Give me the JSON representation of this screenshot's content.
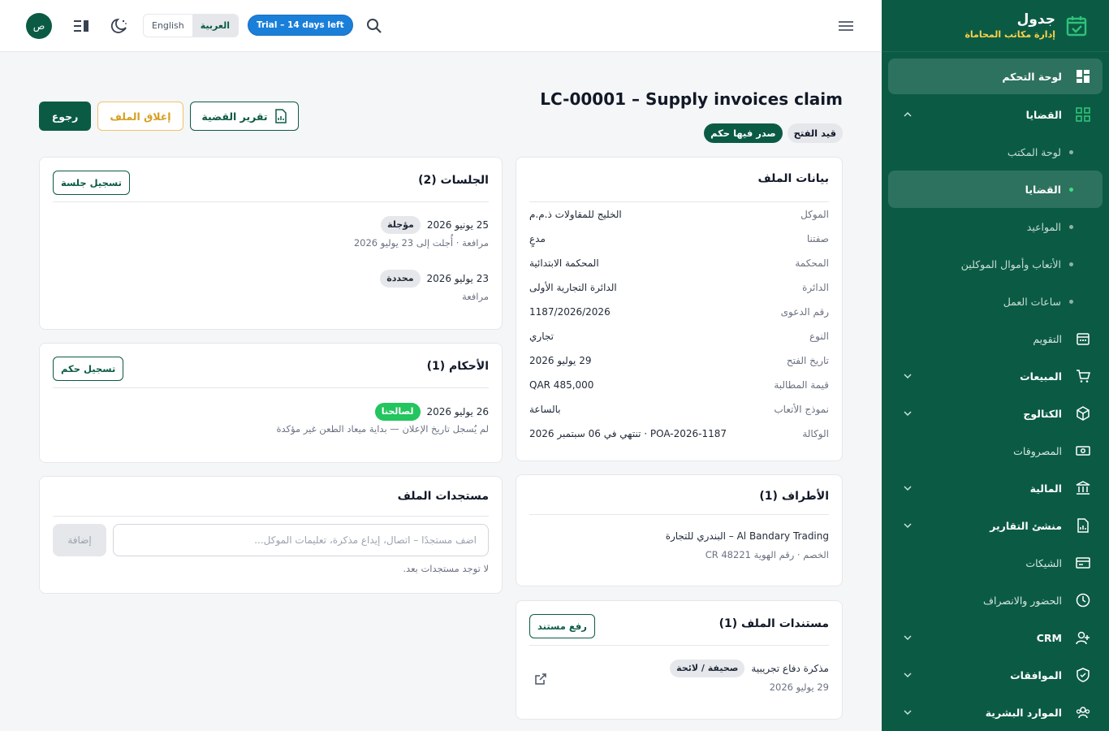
{
  "brand": {
    "name": "جدول",
    "subtitle": "إدارة مكاتب المحاماة"
  },
  "sidebar": {
    "items": [
      {
        "label": "لوحة التحكم"
      },
      {
        "label": "القضايا"
      },
      {
        "label": "لوحة المكتب"
      },
      {
        "label": "القضايا"
      },
      {
        "label": "المواعيد"
      },
      {
        "label": "الأتعاب وأموال الموكلين"
      },
      {
        "label": "ساعات العمل"
      },
      {
        "label": "التقويم"
      },
      {
        "label": "المبيعات"
      },
      {
        "label": "الكتالوج"
      },
      {
        "label": "المصروفات"
      },
      {
        "label": "المالية"
      },
      {
        "label": "منشئ التقارير"
      },
      {
        "label": "الشيكات"
      },
      {
        "label": "الحضور والانصراف"
      },
      {
        "label": "CRM"
      },
      {
        "label": "الموافقات"
      },
      {
        "label": "الموارد البشرية"
      }
    ]
  },
  "topbar": {
    "avatar": "ص",
    "lang_en": "English",
    "lang_ar": "العربية",
    "trial": "Trial – 14 days left"
  },
  "page": {
    "title": "LC-00001 – Supply invoices claim",
    "status_open": "قيد الفتح",
    "status_judged": "صدر فيها حكم",
    "btn_back": "رجوع",
    "btn_close": "إغلاق الملف",
    "btn_report": "تقرير القضية"
  },
  "file_info": {
    "title": "بيانات الملف",
    "rows": [
      {
        "k": "الموكل",
        "v": "الخليج للمقاولات ذ.م.م"
      },
      {
        "k": "صفتنا",
        "v": "مدعٍ"
      },
      {
        "k": "المحكمة",
        "v": "المحكمة الابتدائية"
      },
      {
        "k": "الدائرة",
        "v": "الدائرة التجارية الأولى"
      },
      {
        "k": "رقم الدعوى",
        "v": "1187/2026/2026"
      },
      {
        "k": "النوع",
        "v": "تجاري"
      },
      {
        "k": "تاريخ الفتح",
        "v": "29 يوليو 2026"
      },
      {
        "k": "قيمة المطالبة",
        "v": "QAR 485,000"
      },
      {
        "k": "نموذج الأتعاب",
        "v": "بالساعة"
      },
      {
        "k": "الوكالة",
        "v": "POA-2026-1187 · تنتهي في 06 سبتمبر 2026"
      }
    ]
  },
  "parties": {
    "title": "الأطراف (1)",
    "name": "Al Bandary Trading – البندري للتجارة",
    "detail": "الخصم · رقم الهوية CR 48221"
  },
  "documents": {
    "title": "مستندات الملف (1)",
    "upload_btn": "رفع مستند",
    "doc_name": "مذكرة دفاع تجريبية",
    "doc_type": "صحيفة / لائحة",
    "doc_date": "29 يوليو 2026"
  },
  "sessions": {
    "title": "الجلسات (2)",
    "add_btn": "تسجيل جلسة",
    "items": [
      {
        "date": "25 يونيو 2026",
        "status": "مؤجلة",
        "note": "مرافعة · أُجلت إلى 23 يوليو 2026"
      },
      {
        "date": "23 يوليو 2026",
        "status": "محددة",
        "note": "مرافعة"
      }
    ]
  },
  "rulings": {
    "title": "الأحكام (1)",
    "add_btn": "تسجيل حكم",
    "date": "26 يوليو 2026",
    "status": "لصالحنا",
    "note": "لم يُسجل تاريخ الإعلان — بداية ميعاد الطعن غير مؤكدة"
  },
  "todos": {
    "title": "مستجدات الملف",
    "placeholder": "اضف مستجدًا – اتصال، إيداع مذكرة، تعليمات الموكل...",
    "add_btn": "إضافة",
    "empty": "لا توجد مستجدات بعد."
  },
  "colors": {
    "primary": "#0b5b44",
    "accent": "#ffd24a",
    "trial": "#1a7fd9",
    "success": "#22c55e"
  },
  "icons": [
    "calendar-check-icon",
    "dashboard-icon",
    "grid-icon",
    "calendar-icon",
    "cart-icon",
    "cube-icon",
    "cash-icon",
    "bank-icon",
    "report-icon",
    "card-icon",
    "clock-icon",
    "user-plus-icon",
    "shield-icon",
    "users-icon",
    "search-icon",
    "menu-icon",
    "moon-icon",
    "sidebar-toggle-icon",
    "external-link-icon",
    "file-chart-icon"
  ]
}
